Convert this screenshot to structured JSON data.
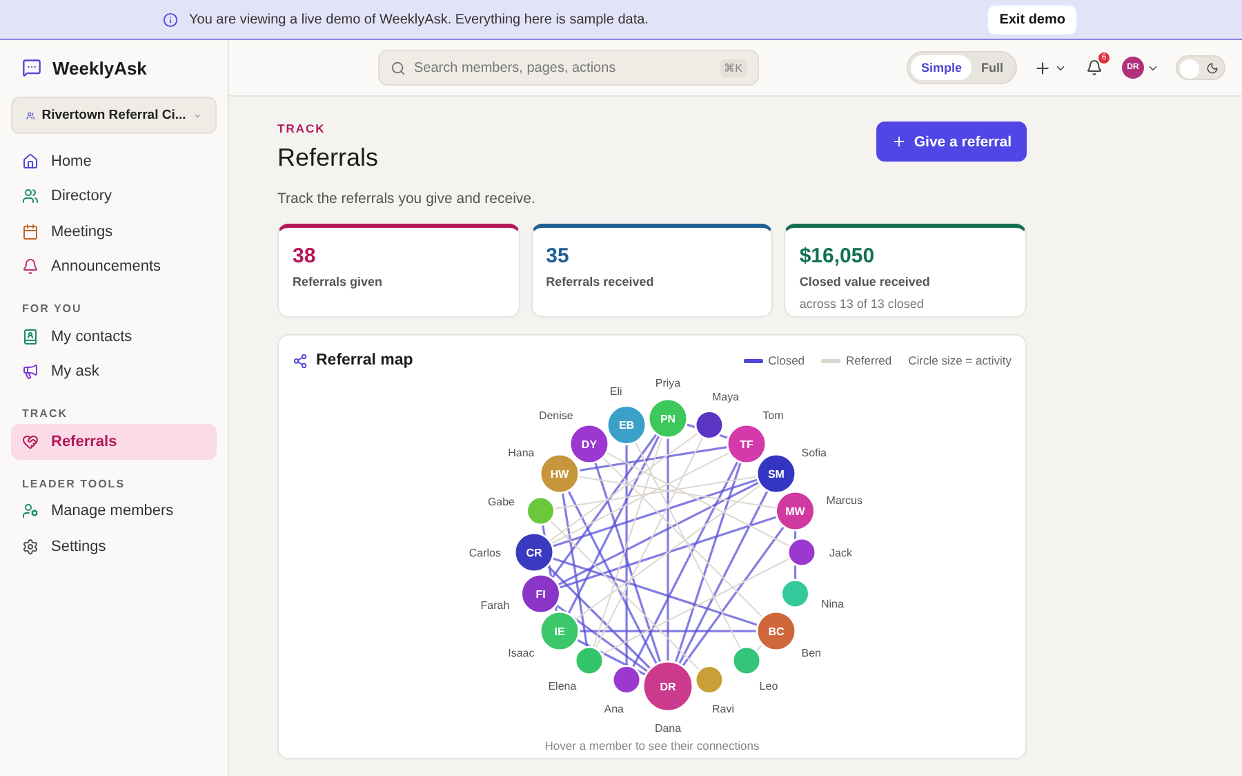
{
  "banner": {
    "message": "You are viewing a live demo of WeeklyAsk. Everything here is sample data.",
    "button": "Exit demo"
  },
  "sidebar": {
    "brand": "WeeklyAsk",
    "group_picker": "Rivertown Referral Ci...",
    "sections": [
      {
        "items": [
          {
            "label": "Home",
            "selected": false
          },
          {
            "label": "Directory",
            "selected": false
          },
          {
            "label": "Meetings",
            "selected": false
          },
          {
            "label": "Announcements",
            "selected": false
          }
        ]
      },
      {
        "heading": "FOR YOU",
        "items": [
          {
            "label": "My contacts",
            "selected": false
          },
          {
            "label": "My ask",
            "selected": false
          }
        ]
      },
      {
        "heading": "TRACK",
        "items": [
          {
            "label": "Referrals",
            "selected": true
          }
        ]
      },
      {
        "heading": "LEADER TOOLS",
        "items": [
          {
            "label": "Manage members",
            "selected": false
          },
          {
            "label": "Settings",
            "selected": false
          }
        ]
      }
    ]
  },
  "header": {
    "search": {
      "placeholder": "Search members, pages, actions",
      "shortcut": "⌘K"
    },
    "modes": [
      {
        "label": "Simple",
        "selected": true
      },
      {
        "label": "Full",
        "selected": false
      }
    ],
    "notifications": "6",
    "avatar": "DR",
    "dark_mode": {
      "on": false
    }
  },
  "page": {
    "eyebrow": "TRACK",
    "title": "Referrals",
    "subtitle": "Track the referrals you give and receive.",
    "action": "Give a referral"
  },
  "stats": [
    {
      "value": "38",
      "label": "Referrals given",
      "color": "#b3195a"
    },
    {
      "value": "35",
      "label": "Referrals received",
      "color": "#1f5f95"
    },
    {
      "value": "$16,050",
      "label": "Closed value received",
      "note": "across 13 of 13 closed",
      "color": "#127050"
    }
  ],
  "map": {
    "title": "Referral map",
    "legend": [
      "Closed",
      "Referred",
      "Circle size = activity"
    ],
    "hint": "Hover a member to see their connections",
    "members": [
      {
        "name": "Eli",
        "initials": "EB",
        "kind": "medium",
        "color": "#3aa0c8"
      },
      {
        "name": "Priya",
        "initials": "PN",
        "kind": "medium",
        "color": "#3cc85a"
      },
      {
        "name": "Maya",
        "kind": "small",
        "color": "#5b34c4"
      },
      {
        "name": "Denise",
        "initials": "DY",
        "kind": "medium",
        "color": "#9b38d0"
      },
      {
        "name": "Tom",
        "initials": "TF",
        "kind": "medium",
        "color": "#d43aaa"
      },
      {
        "name": "Hana",
        "initials": "HW",
        "kind": "medium",
        "color": "#c8963a"
      },
      {
        "name": "Sofia",
        "initials": "SM",
        "kind": "medium",
        "color": "#3535c4"
      },
      {
        "name": "Gabe",
        "kind": "small",
        "color": "#6ac83a"
      },
      {
        "name": "Marcus",
        "initials": "MW",
        "kind": "medium",
        "color": "#d03aa0"
      },
      {
        "name": "Carlos",
        "initials": "CR",
        "kind": "medium",
        "color": "#3a3ac0"
      },
      {
        "name": "Jack",
        "kind": "small",
        "color": "#9b38d0"
      },
      {
        "name": "Farah",
        "initials": "FI",
        "kind": "medium",
        "color": "#8a34c8"
      },
      {
        "name": "Nina",
        "kind": "small",
        "color": "#34c99a"
      },
      {
        "name": "Isaac",
        "initials": "IE",
        "kind": "medium",
        "color": "#3cc86a"
      },
      {
        "name": "Ben",
        "initials": "BC",
        "kind": "medium",
        "color": "#cf673a"
      },
      {
        "name": "Elena",
        "kind": "small",
        "color": "#34c46a"
      },
      {
        "name": "Leo",
        "kind": "small",
        "color": "#34c47a"
      },
      {
        "name": "Ana",
        "kind": "small",
        "color": "#9b38d0"
      },
      {
        "name": "Dana",
        "initials": "DR",
        "kind": "large",
        "color": "#cc3a8e"
      },
      {
        "name": "Ravi",
        "kind": "small",
        "color": "#c8a03a"
      }
    ]
  }
}
